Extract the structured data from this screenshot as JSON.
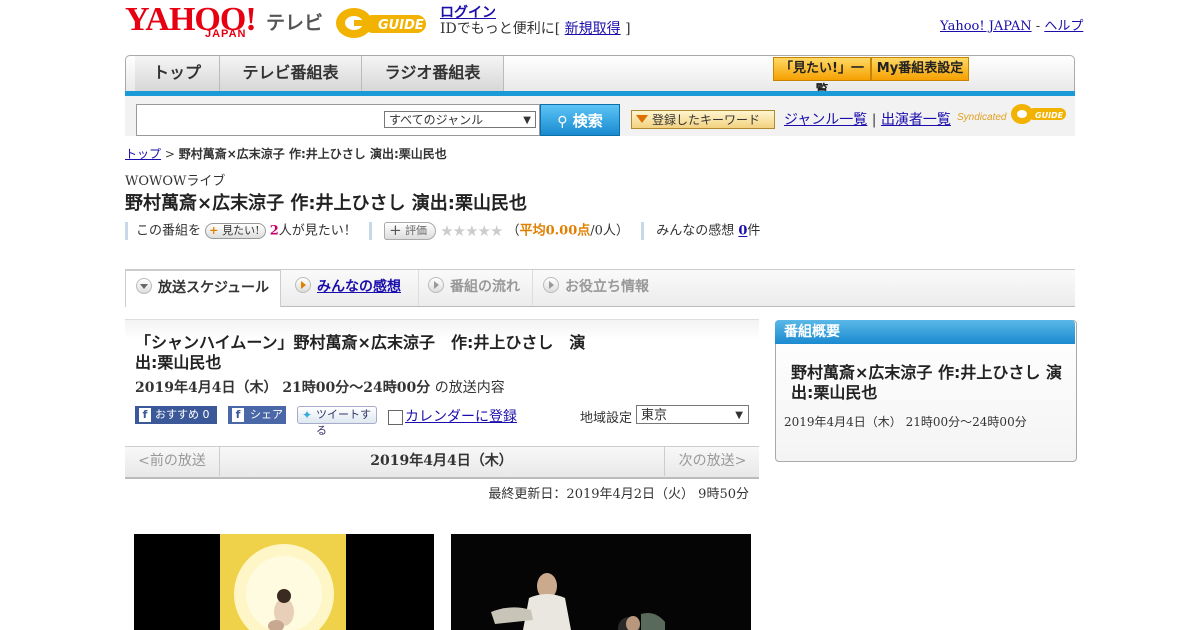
{
  "header": {
    "yahoo_logo": "YAHOO!",
    "japan_logo": "JAPAN",
    "tv_label": "テレビ",
    "gguide_logo": "G-GUIDE",
    "login_link": "ログイン",
    "login_promo": "IDでもっと便利に[",
    "signup_link": "新規取得",
    "login_promo_end": "]",
    "yahoo_japan_link": "Yahoo! JAPAN",
    "dash": "-",
    "help_link": "ヘルプ"
  },
  "nav": {
    "tabs": [
      "トップ",
      "テレビ番組表",
      "ラジオ番組表"
    ],
    "mitai_list": "「見たい!」一覧",
    "my_schedule": "My番組表設定"
  },
  "search": {
    "genre_selected": "すべてのジャンル",
    "button_label": "検索",
    "keyword_button": "登録したキーワード",
    "genre_list_link": "ジャンル一覧",
    "separator": "|",
    "performer_list_link": "出演者一覧",
    "syndicated": "Syndicated"
  },
  "breadcrumb": {
    "top": "トップ",
    "sep": ">",
    "current": "野村萬斎×広末涼子 作:井上ひさし 演出:栗山民也"
  },
  "program": {
    "channel": "WOWOWライブ",
    "title": "野村萬斎×広末涼子 作:井上ひさし 演出:栗山民也",
    "meta": {
      "this_program": "この番組を",
      "mitai_button": "見たい!",
      "mitai_count": "2",
      "mitai_suffix": "人が見たい！",
      "hyoka_button": "評価",
      "avg_open": "（",
      "avg_label": "平均0.00点",
      "avg_people": "/0人）",
      "impressions_label": "みんなの感想",
      "impressions_count": "0",
      "impressions_suffix": "件"
    }
  },
  "subtabs": [
    "放送スケジュール",
    "みんなの感想",
    "番組の流れ",
    "お役立ち情報"
  ],
  "episode": {
    "title": "「シャンハイムーン」野村萬斎×広末涼子　作:井上ひさし　演出:栗山民也",
    "date": "2019年4月4日（木） 21時00分～24時00分",
    "date_suffix": "の放送内容",
    "fb_recommend": "おすすめ 0",
    "fb_share": "シェア",
    "tweet": "ツイートする",
    "calendar": "カレンダーに登録",
    "region_label": "地域設定",
    "region_selected": "東京"
  },
  "date_nav": {
    "prev": "<前の放送",
    "current": "2019年4月4日（木）",
    "next": "次の放送>"
  },
  "updated": "最終更新日：2019年4月2日（火） 9時50分",
  "sidebar": {
    "heading": "番組概要",
    "title": "野村萬斎×広末涼子 作:井上ひさし 演出:栗山民也",
    "date": "2019年4月4日（木） 21時00分～24時00分"
  },
  "colors": {
    "yahoo_red": "#e60012",
    "nav_blue": "#1a9ad6",
    "link": "#1a0dab",
    "accent_orange": "#f5a000"
  }
}
